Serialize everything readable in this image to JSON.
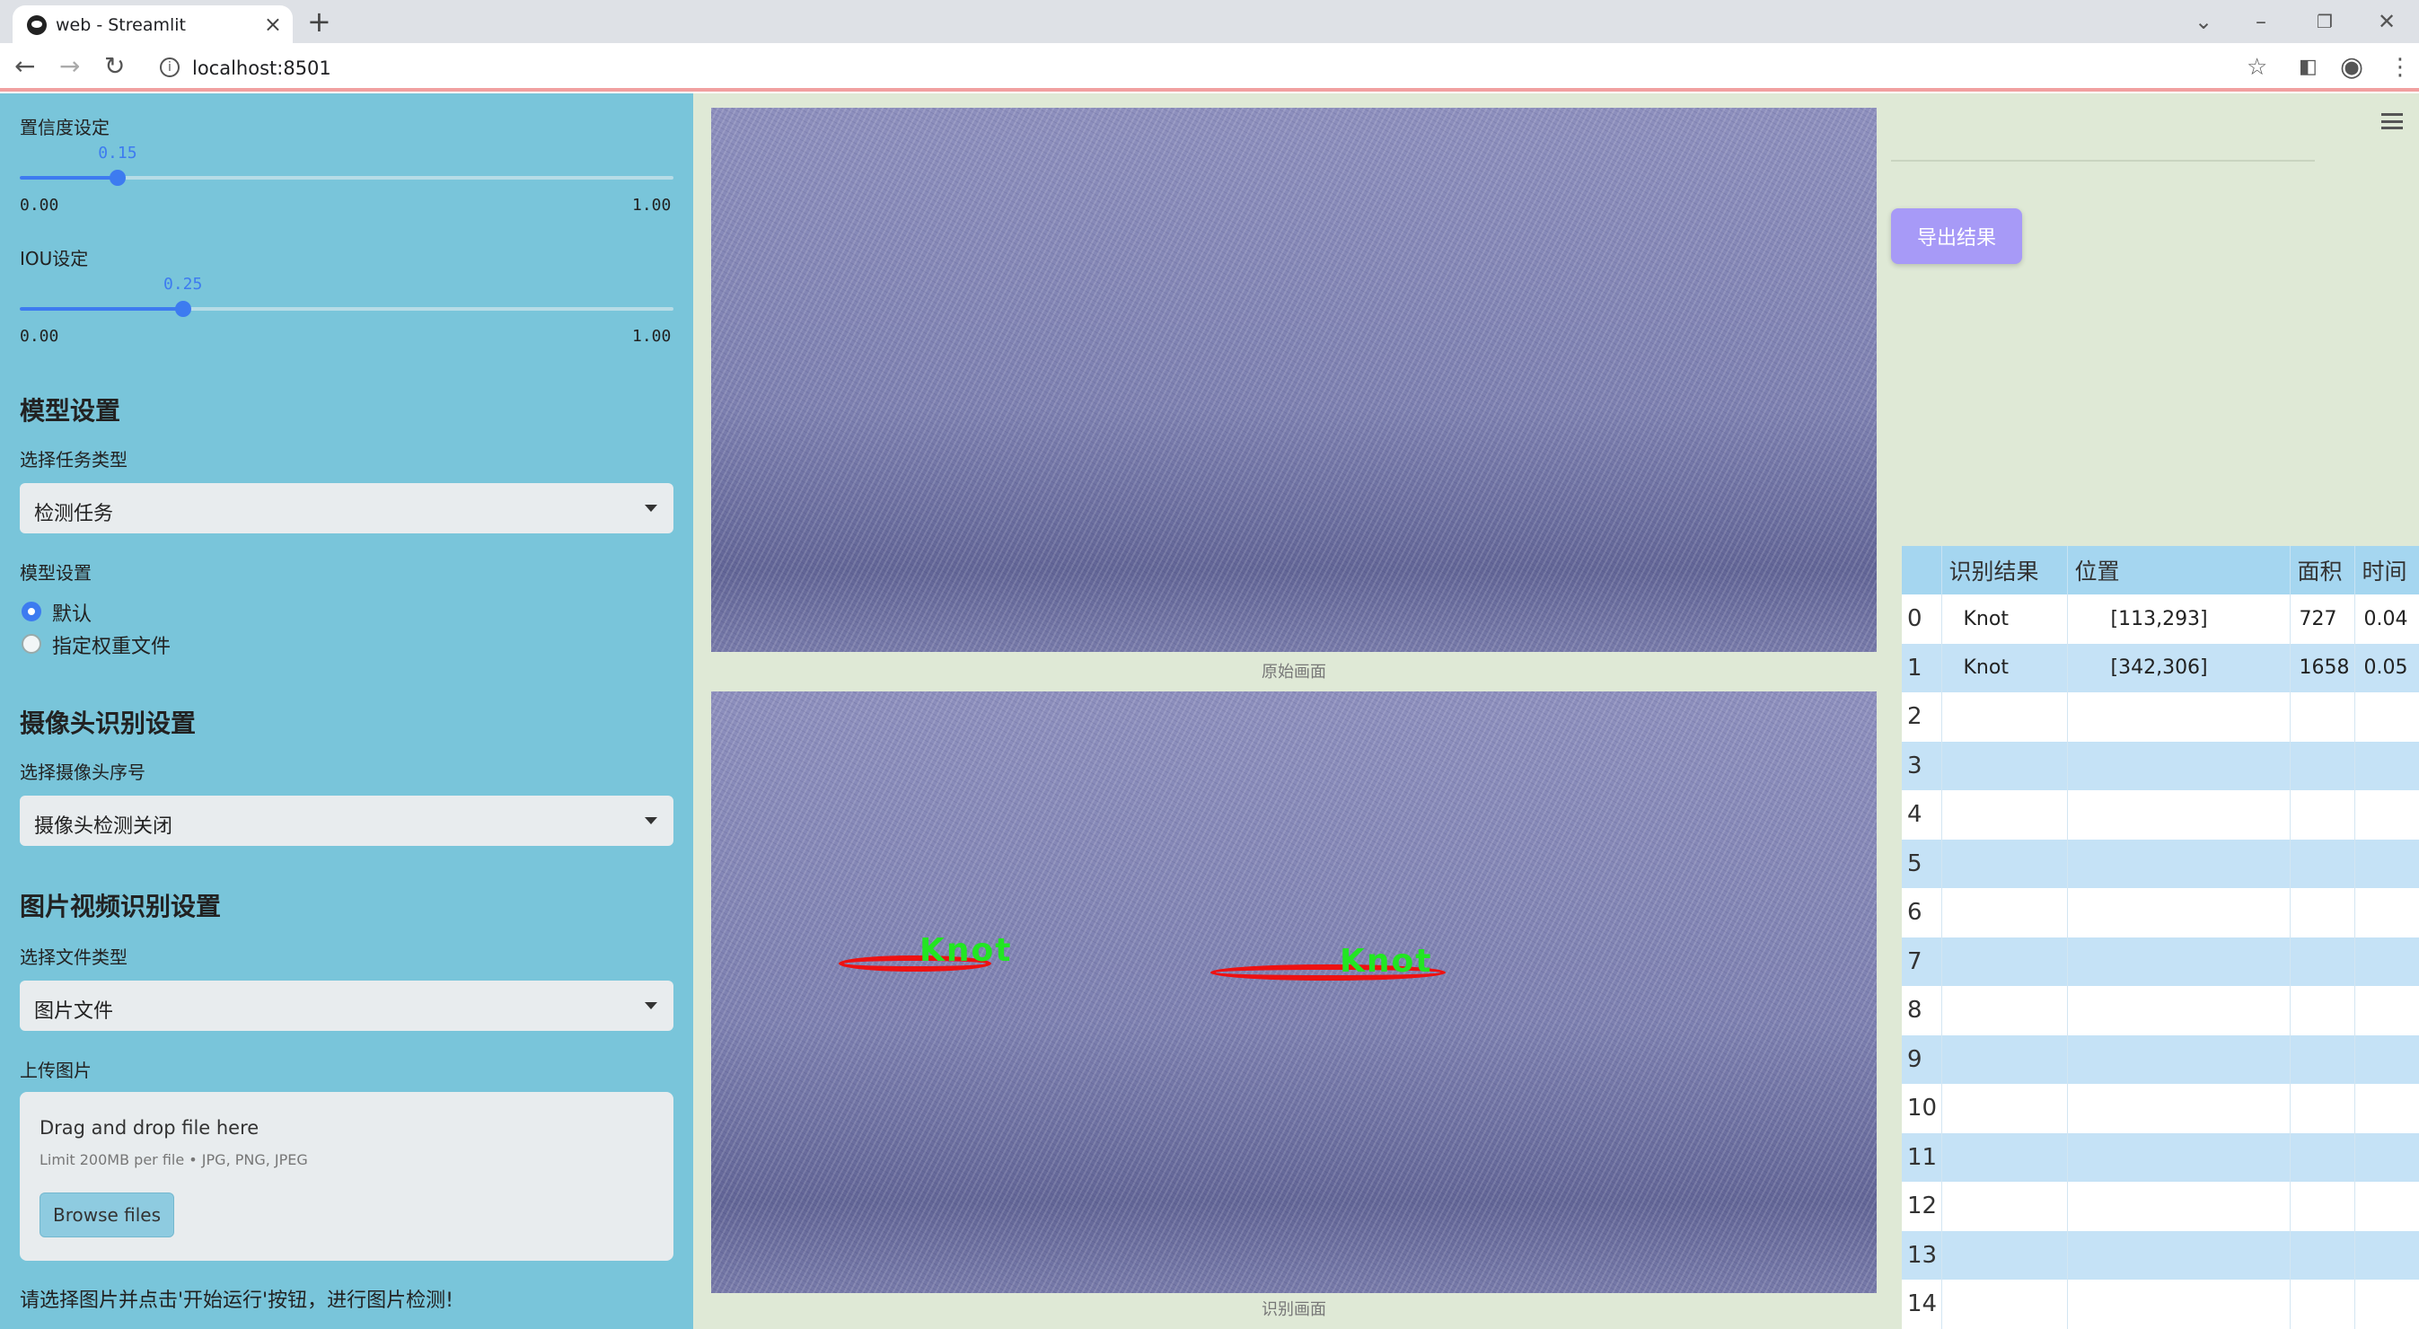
{
  "browser": {
    "tab_title": "web - Streamlit",
    "url": "localhost:8501"
  },
  "sidebar": {
    "confidence": {
      "label": "置信度设定",
      "value": "0.15",
      "min": "0.00",
      "max": "1.00",
      "fraction": 0.15
    },
    "iou": {
      "label": "IOU设定",
      "value": "0.25",
      "min": "0.00",
      "max": "1.00",
      "fraction": 0.25
    },
    "model_heading": "模型设置",
    "task_label": "选择任务类型",
    "task_value": "检测任务",
    "model_label": "模型设置",
    "model_options": [
      "默认",
      "指定权重文件"
    ],
    "model_selected": 0,
    "camera_heading": "摄像头识别设置",
    "camera_label": "选择摄像头序号",
    "camera_value": "摄像头检测关闭",
    "media_heading": "图片视频识别设置",
    "file_type_label": "选择文件类型",
    "file_type_value": "图片文件",
    "upload_label": "上传图片",
    "upload_drop": "Drag and drop file here",
    "upload_limit": "Limit 200MB per file • JPG, PNG, JPEG",
    "browse_label": "Browse files",
    "hint": "请选择图片并点击'开始运行'按钮，进行图片检测!"
  },
  "main": {
    "original_caption": "原始画面",
    "result_caption": "识别画面",
    "detections": [
      "Knot",
      "Knot"
    ],
    "export_label": "导出结果"
  },
  "table": {
    "headers": [
      "",
      "识别结果",
      "位置",
      "面积",
      "时间"
    ],
    "rows": [
      [
        "0",
        "Knot",
        "[113,293]",
        "727",
        "0.04"
      ],
      [
        "1",
        "Knot",
        "[342,306]",
        "1658",
        "0.05"
      ],
      [
        "2",
        "",
        "",
        "",
        ""
      ],
      [
        "3",
        "",
        "",
        "",
        ""
      ],
      [
        "4",
        "",
        "",
        "",
        ""
      ],
      [
        "5",
        "",
        "",
        "",
        ""
      ],
      [
        "6",
        "",
        "",
        "",
        ""
      ],
      [
        "7",
        "",
        "",
        "",
        ""
      ],
      [
        "8",
        "",
        "",
        "",
        ""
      ],
      [
        "9",
        "",
        "",
        "",
        ""
      ],
      [
        "10",
        "",
        "",
        "",
        ""
      ],
      [
        "11",
        "",
        "",
        "",
        ""
      ],
      [
        "12",
        "",
        "",
        "",
        ""
      ],
      [
        "13",
        "",
        "",
        "",
        ""
      ],
      [
        "14",
        "",
        "",
        "",
        ""
      ]
    ]
  },
  "colors": {
    "sidebar_bg": "#79c5da",
    "main_bg": "#dfe9d6",
    "accent": "#3d7bf0",
    "export_button": "#a79af7",
    "table_header": "#a5d6f0",
    "table_stripe": "#c5e2f6",
    "detection_box": "#ee1111",
    "detection_label": "#22e622"
  },
  "icons": {
    "tab_favicon": "streamlit-icon",
    "back": "back-arrow-icon",
    "forward": "forward-arrow-icon",
    "reload": "reload-icon",
    "site_info": "info-icon",
    "bookmark": "star-icon",
    "sidepanel": "side-panel-icon",
    "profile": "profile-icon",
    "menu": "kebab-menu-icon",
    "app_menu": "hamburger-icon"
  }
}
